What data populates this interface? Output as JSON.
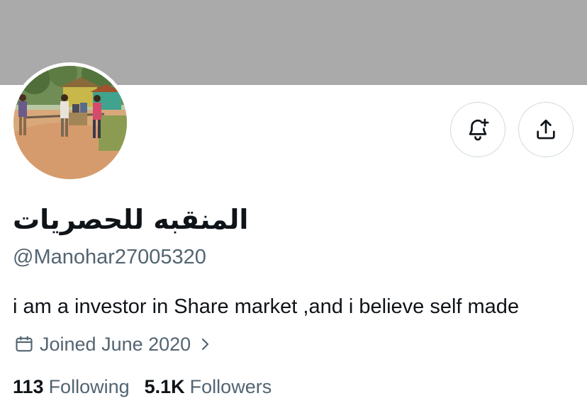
{
  "profile": {
    "display_name": "المنقبه للحصريات",
    "handle": "@Manohar27005320",
    "bio": "i am a investor in Share market ,and i believe self made",
    "joined": "Joined June 2020"
  },
  "stats": {
    "following_count": "113",
    "following_label": "Following",
    "followers_count": "5.1K",
    "followers_label": "Followers"
  },
  "icons": {
    "notify": "bell-plus-icon",
    "share": "share-upload-icon",
    "calendar": "calendar-icon",
    "chevron": "chevron-right-icon"
  },
  "colors": {
    "banner": "#aaaaaa",
    "primary_text": "#0f1419",
    "secondary_text": "#536471",
    "button_border": "#cfd9de"
  }
}
